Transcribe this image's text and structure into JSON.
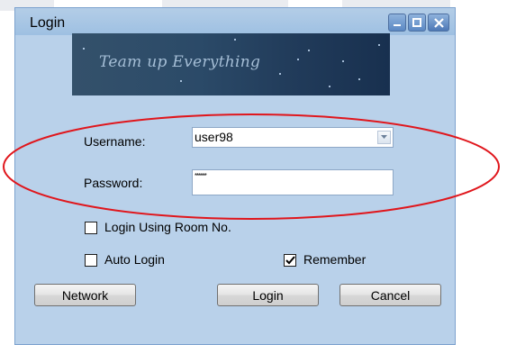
{
  "window": {
    "title": "Login",
    "controls": {
      "minimize_icon": "minimize-icon",
      "maximize_icon": "maximize-icon",
      "close_icon": "close-icon"
    }
  },
  "banner": {
    "text": "Team up Everything"
  },
  "form": {
    "username_label": "Username:",
    "username_value": "user98",
    "password_label": "Password:",
    "password_mask": "******",
    "room_checkbox_label": "Login Using Room No.",
    "room_checked": false,
    "auto_login_label": "Auto Login",
    "auto_login_checked": false,
    "remember_label": "Remember",
    "remember_checked": true
  },
  "buttons": {
    "network": "Network",
    "login": "Login",
    "cancel": "Cancel"
  },
  "colors": {
    "dialog_bg": "#b9d1ea",
    "annotation": "#e0161c"
  }
}
